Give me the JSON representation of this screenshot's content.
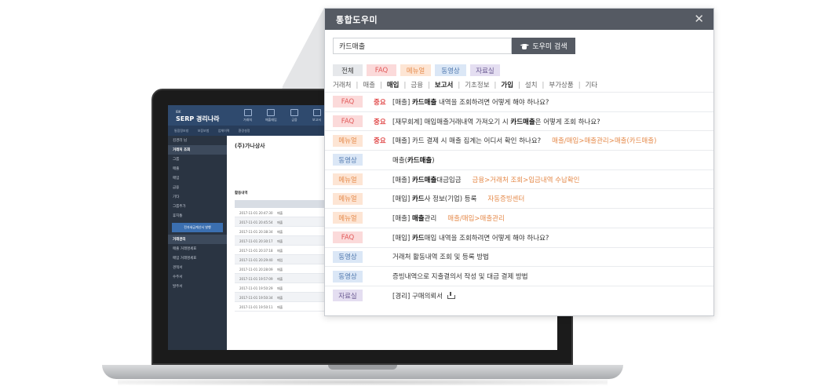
{
  "popup": {
    "title": "통합도우미",
    "close_glyph": "✕",
    "search": {
      "value": "카드매출",
      "placeholder": "",
      "button_label": "도우미 검색",
      "button_icon": "graduation-cap-icon"
    },
    "filters": [
      "전체",
      "FAQ",
      "메뉴얼",
      "동영상",
      "자료실"
    ],
    "categories": [
      {
        "label": "거래처",
        "bold": false
      },
      {
        "label": "매출",
        "bold": false
      },
      {
        "label": "매입",
        "bold": true
      },
      {
        "label": "금융",
        "bold": false
      },
      {
        "label": "보고서",
        "bold": true
      },
      {
        "label": "기초정보",
        "bold": false
      },
      {
        "label": "가입",
        "bold": true
      },
      {
        "label": "설치",
        "bold": false
      },
      {
        "label": "부가상품",
        "bold": false
      },
      {
        "label": "기타",
        "bold": false
      }
    ],
    "category_separator": "|",
    "results": [
      {
        "type": "FAQ",
        "important": "중요",
        "pre": "[매출] ",
        "bold": "카드매출",
        "post": " 내역을 조회하려면 어떻게 해야 하나요?",
        "path": "",
        "download": false
      },
      {
        "type": "FAQ",
        "important": "중요",
        "pre": "[재무회계] 매입매출거래내역 가져오기 시 ",
        "bold": "카드매출",
        "post": "은 어떻게 조회 하나요?",
        "path": "",
        "download": false
      },
      {
        "type": "메뉴얼",
        "important": "중요",
        "pre": "[매출] 카드 결제 시 매출 집계는 어디서 확인 하나요?",
        "bold": "",
        "post": "",
        "path": "매출/매입>매출관리>매출(카드매출)",
        "download": false
      },
      {
        "type": "동영상",
        "important": "",
        "pre": "매출(",
        "bold": "카드매출",
        "post": ")",
        "path": "",
        "download": false
      },
      {
        "type": "메뉴얼",
        "important": "",
        "pre": "[매출] ",
        "bold": "카드매출",
        "post": "대금입금",
        "path": "금융>거래처 조회>입금내역 수납확인",
        "download": false
      },
      {
        "type": "메뉴얼",
        "important": "",
        "pre": "[매입] ",
        "bold": "카드",
        "post": "사 정보(기업) 등록",
        "path": "자동증빙센터",
        "download": false
      },
      {
        "type": "메뉴얼",
        "important": "",
        "pre": "[매출] ",
        "bold": "매출",
        "post": "관리",
        "path": "매출/매입>매출관리",
        "download": false
      },
      {
        "type": "FAQ",
        "important": "",
        "pre": "[매입] ",
        "bold": "카드",
        "post": "매입 내역을 조회하려면 어떻게 해야 하나요?",
        "path": "",
        "download": false
      },
      {
        "type": "동영상",
        "important": "",
        "pre": "거래처 활동내역 조회 및 등록 방법",
        "bold": "",
        "post": "",
        "path": "",
        "download": false
      },
      {
        "type": "동영상",
        "important": "",
        "pre": "증빙내역으로 지출결의서 작성 및 대금 결제 방법",
        "bold": "",
        "post": "",
        "path": "",
        "download": false
      },
      {
        "type": "자료실",
        "important": "",
        "pre": "[경리] 구매의뢰서",
        "bold": "",
        "post": "",
        "path": "",
        "download": true
      }
    ]
  },
  "laptop_app": {
    "logo_sub": "IBK",
    "logo": "SERP 경리나라",
    "nav": [
      "거래처",
      "매출매입",
      "금융",
      "보고서"
    ],
    "subnav": [
      "통합정보창",
      "보증보험",
      "업체이력",
      "환경설정"
    ],
    "company": "(주)가나상사",
    "side_rows": [
      "김경리 님",
      "거래처 조회",
      "그룹",
      "매출",
      "매입",
      "금융",
      "기타",
      "그룹추가",
      "휴지통"
    ],
    "side_button": "전자세금계산서 발행",
    "side_menu": [
      "거래관리",
      "매출 거래명세표",
      "매입 거래명세표",
      "견적서",
      "수주서",
      "발주서"
    ],
    "tab_label": "활동내역",
    "table_dates": [
      "2017-11-01 20:47:30",
      "2017-11-01 20:45:54",
      "2017-11-01 20:38:34",
      "2017-11-01 20:30:17",
      "2017-11-01 20:37:18",
      "2017-11-01 20:29:40",
      "2017-11-01 20:28:09",
      "2017-11-01 19:57:09",
      "2017-11-01 19:50:29",
      "2017-11-01 19:50:34",
      "2017-11-01 19:50:11"
    ],
    "table_kind": [
      "매출",
      "매출",
      "매출",
      "매출",
      "매출",
      "매입",
      "매출",
      "매출",
      "매출",
      "매출",
      "매출"
    ],
    "colors": {
      "header": "#2f4a6e",
      "sidebar": "#2a3442",
      "accent": "#3b6fb0"
    }
  },
  "colors": {
    "popup_header": "#555a63",
    "faq": "#e25a5a",
    "manual": "#e58a4a",
    "video": "#4d76ad",
    "data_room": "#6a5a92",
    "important": "#e04848"
  }
}
